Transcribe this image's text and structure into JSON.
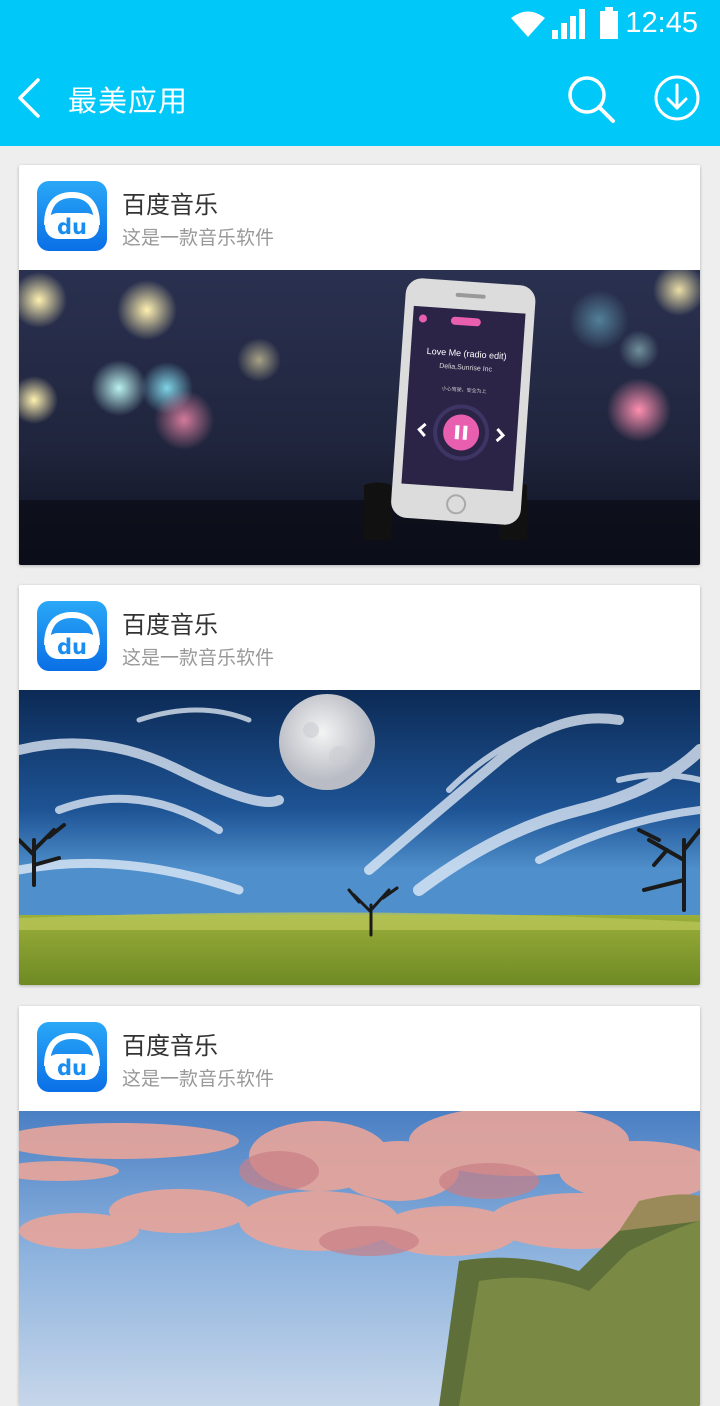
{
  "status_bar": {
    "time": "12:45",
    "icons": [
      "wifi-icon",
      "signal-icon",
      "battery-icon"
    ]
  },
  "app_bar": {
    "title": "最美应用",
    "icons": [
      "back-arrow-icon",
      "search-icon",
      "download-icon"
    ]
  },
  "cards": [
    {
      "name": "百度音乐",
      "description": "这是一款音乐软件",
      "logo_text": "du",
      "image": {
        "song_title": "Love Me (radio edit)",
        "song_artist": "Delia,Sunrise Inc",
        "song_note": "小心驾驶，安全为上"
      }
    },
    {
      "name": "百度音乐",
      "description": "这是一款音乐软件",
      "logo_text": "du"
    },
    {
      "name": "百度音乐",
      "description": "这是一款音乐软件",
      "logo_text": "du"
    }
  ],
  "colors": {
    "primary": "#00c8f8",
    "logo_blue": "#1a8ef0",
    "title_text": "#333333",
    "subtitle_text": "#999999"
  }
}
